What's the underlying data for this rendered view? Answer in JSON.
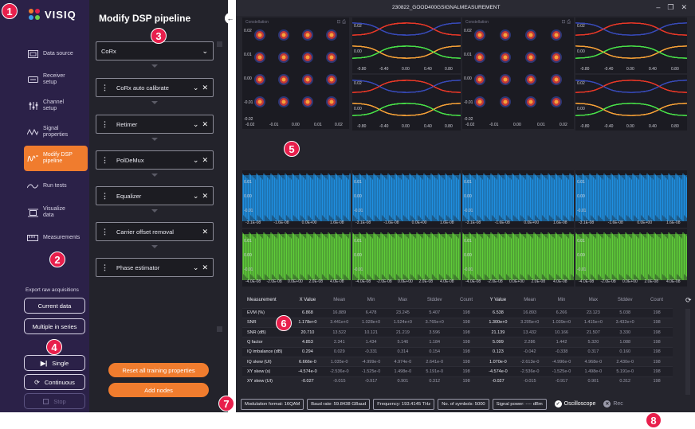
{
  "colors": {
    "sidebar_bg": "#2b2148",
    "accent": "#f07c2e",
    "callout": "#e81f4c",
    "panel_bg": "#23232b",
    "main_bg": "#25252d",
    "constellation_outer": "#3a4db8",
    "constellation_mid": "#e83a2a",
    "constellation_inner": "#f6a23a",
    "waveform_blue": "#1f8fe0",
    "waveform_green": "#5fcc3a"
  },
  "logo": {
    "text": "VISIQ"
  },
  "sidebar": {
    "items": [
      {
        "label": "Data source",
        "icon": "data-source-icon"
      },
      {
        "label": "Receiver setup",
        "icon": "receiver-icon"
      },
      {
        "label": "Channel setup",
        "icon": "channel-icon"
      },
      {
        "label": "Signal properties",
        "icon": "signal-icon"
      },
      {
        "label": "Modify DSP pipeline",
        "icon": "dsp-icon",
        "active": true
      },
      {
        "label": "Run tests",
        "icon": "run-tests-icon"
      },
      {
        "label": "Visualize data",
        "icon": "visualize-icon"
      },
      {
        "label": "Measurements",
        "icon": "measurements-icon"
      }
    ],
    "export_label": "Export raw acquisitions",
    "current_data": "Current data",
    "multiple_in_series": "Multiple in series",
    "single": "Single",
    "continuous": "Continuous",
    "stop": "Stop"
  },
  "pipeline": {
    "title": "Modify DSP pipeline",
    "nodes": [
      {
        "label": "CoRx",
        "removable": false,
        "draggable": false
      },
      {
        "label": "CoRx auto calibrate",
        "removable": true,
        "draggable": true
      },
      {
        "label": "Retimer",
        "removable": true,
        "draggable": true
      },
      {
        "label": "PolDeMux",
        "removable": true,
        "draggable": true
      },
      {
        "label": "Equalizer",
        "removable": true,
        "draggable": true
      },
      {
        "label": "Carrier offset removal",
        "removable": true,
        "draggable": true,
        "no_expand": true
      },
      {
        "label": "Phase estimator",
        "removable": true,
        "draggable": true
      }
    ],
    "reset_button": "Reset all training properties",
    "add_nodes_button": "Add nodes"
  },
  "window": {
    "title": "230822_GOOD400GSIGNALMEASUREMENT"
  },
  "plots": {
    "constellation_title": "Constellation",
    "const_ticks_y": [
      "0.02",
      "0.01",
      "0.00",
      "-0.01",
      "-0.02"
    ],
    "const_ticks_x": [
      "-0.02",
      "-0.01",
      "0.00",
      "0.01",
      "0.02"
    ],
    "eye_ticks_y_top": [
      "0.02",
      "0.01",
      "0.00",
      "-0.01"
    ],
    "eye_ticks_x": [
      "-0.80",
      "-0.40",
      "0.00",
      "0.40",
      "0.80"
    ],
    "eye_ticks_y_bottom": [
      "0.02",
      "0.01",
      "0.00",
      "-0.01"
    ],
    "wave_ticks_y": [
      "0.01",
      "0.00",
      "-0.01"
    ],
    "wave_ticks_x_blue": [
      "-3.1E-08",
      "-1.6E-08",
      "0.0E+00",
      "1.6E-08"
    ],
    "wave_ticks_x_green": [
      "-4.0E-08",
      "-2.0E-08",
      "0.0E+00",
      "2.0E-08",
      "4.0E-08"
    ]
  },
  "stats": {
    "headers": [
      "Measurement",
      "X Value",
      "Mean",
      "Min",
      "Max",
      "Stddev",
      "Count",
      "Y Value",
      "Mean",
      "Min",
      "Max",
      "Stddev",
      "Count"
    ],
    "rows": [
      [
        "EVM (%)",
        "6.868",
        "16.889",
        "6.478",
        "23.245",
        "5.407",
        "198",
        "6.538",
        "16.893",
        "6.266",
        "23.123",
        "5.038",
        "198"
      ],
      [
        "SNR",
        "1.178e+0",
        "3.441e+0",
        "1.028e+0",
        "1.524e+0",
        "3.765e+0",
        "198",
        "1.300e+0",
        "3.205e+0",
        "1.039e+0",
        "1.415e+0",
        "3.432e+0",
        "198"
      ],
      [
        "SNR (dB)",
        "20.710",
        "13.522",
        "10.121",
        "21.219",
        "3.596",
        "198",
        "21.139",
        "13.432",
        "10.166",
        "21.507",
        "3.330",
        "198"
      ],
      [
        "Q factor",
        "4.853",
        "2.341",
        "1.434",
        "5.146",
        "1.184",
        "198",
        "5.099",
        "2.286",
        "1.442",
        "5.320",
        "1.088",
        "198"
      ],
      [
        "IQ imbalance (dB)",
        "0.294",
        "0.029",
        "-0.331",
        "0.314",
        "0.154",
        "198",
        "0.123",
        "-0.042",
        "-0.338",
        "0.317",
        "0.160",
        "198"
      ],
      [
        "IQ skew (UI)",
        "6.666e-0",
        "1.035e-0",
        "-4.999e-0",
        "4.974e-0",
        "2.641e-0",
        "198",
        "1.070e-0",
        "-2.613e-0",
        "-4.996e-0",
        "4.968e-0",
        "2.430e-0",
        "198"
      ],
      [
        "XY skew (s)",
        "-4.574e-0",
        "-2.536e-0",
        "-1.525e-0",
        "1.498e-0",
        "5.191e-0",
        "198",
        "-4.574e-0",
        "-2.536e-0",
        "-1.525e-0",
        "1.498e-0",
        "5.191e-0",
        "198"
      ],
      [
        "XY skew (UI)",
        "-0.027",
        "-0.015",
        "-0.917",
        "0.901",
        "0.312",
        "198",
        "-0.027",
        "-0.015",
        "-0.917",
        "0.901",
        "0.312",
        "198"
      ]
    ]
  },
  "statusbar": {
    "modulation": "Modulation format: 16QAM",
    "baud": "Baud rate: 59.8438 GBaud",
    "frequency": "Frequency: 193.4145 THz",
    "symbols": "No. of symbols: 5000",
    "power": "Signal power: ---- dBm",
    "oscilloscope": "Oscilloscope",
    "record": "Rec"
  },
  "callouts": [
    "1",
    "2",
    "3",
    "4",
    "5",
    "6",
    "7",
    "8"
  ]
}
